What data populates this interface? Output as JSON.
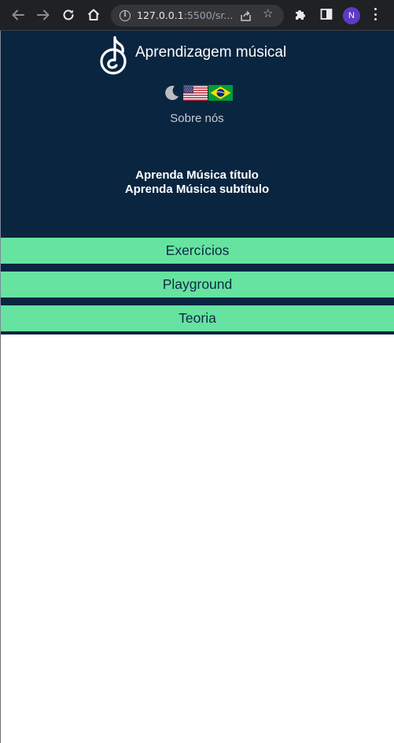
{
  "browser": {
    "url_host": "127.0.0.1",
    "url_rest": ":5500/sr...",
    "profile_initial": "N"
  },
  "header": {
    "logo_icon": "music-note-icon",
    "title": "Aprendizagem músical",
    "theme_toggle_icon": "moon-icon",
    "languages": [
      "en-US",
      "pt-BR"
    ],
    "about_link": "Sobre nós"
  },
  "hero": {
    "title": "Aprenda Música título",
    "subtitle": "Aprenda Música subtítulo"
  },
  "nav": {
    "items": [
      {
        "label": "Exercícios"
      },
      {
        "label": "Playground"
      },
      {
        "label": "Teoria"
      }
    ]
  },
  "colors": {
    "background": "#0a2540",
    "accent": "#66e3a0",
    "nav_text": "#0e2a44",
    "chrome": "#202124"
  }
}
